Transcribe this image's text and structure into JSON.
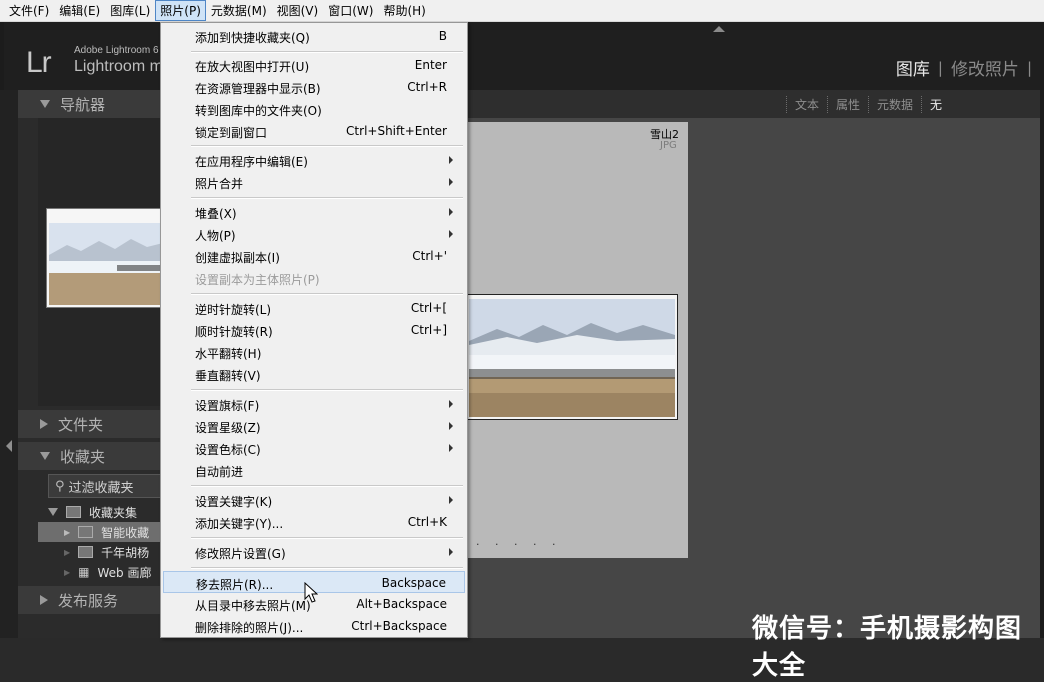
{
  "menubar": {
    "items": [
      {
        "label": "文件(F)"
      },
      {
        "label": "编辑(E)"
      },
      {
        "label": "图库(L)"
      },
      {
        "label": "照片(P)"
      },
      {
        "label": "元数据(M)"
      },
      {
        "label": "视图(V)"
      },
      {
        "label": "窗口(W)"
      },
      {
        "label": "帮助(H)"
      }
    ]
  },
  "identity": {
    "logo": "Lr",
    "brand_line1": "Adobe Lightroom 6",
    "brand_line2": "Lightroom m"
  },
  "modules": {
    "library": "图库",
    "develop": "修改照片"
  },
  "left_panel": {
    "navigator": "导航器",
    "folders": "文件夹",
    "collections": "收藏夹",
    "filter_placeholder": "过滤收藏夹",
    "collection_items": [
      {
        "label": "收藏夹集"
      },
      {
        "label": "智能收藏"
      },
      {
        "label": "千年胡杨"
      },
      {
        "label": "Web 画廊"
      }
    ],
    "publish": "发布服务"
  },
  "toolbar": {
    "items": [
      {
        "label": "文本"
      },
      {
        "label": "属性"
      },
      {
        "label": "元数据"
      },
      {
        "label": "无"
      }
    ]
  },
  "grid": {
    "cell_name": "雪山2",
    "cell_type": "JPG",
    "dots": "· · · · ·"
  },
  "watermark": "微信号：手机摄影构图大全",
  "photo_menu": {
    "items": [
      {
        "label": "添加到快捷收藏夹(Q)",
        "shortcut": "B"
      },
      {
        "label": "在放大视图中打开(U)",
        "shortcut": "Enter"
      },
      {
        "label": "在资源管理器中显示(B)",
        "shortcut": "Ctrl+R"
      },
      {
        "label": "转到图库中的文件夹(O)",
        "shortcut": ""
      },
      {
        "label": "锁定到副窗口",
        "shortcut": "Ctrl+Shift+Enter"
      },
      {
        "label": "在应用程序中编辑(E)",
        "shortcut": ""
      },
      {
        "label": "照片合并",
        "shortcut": ""
      },
      {
        "label": "堆叠(X)",
        "shortcut": ""
      },
      {
        "label": "人物(P)",
        "shortcut": ""
      },
      {
        "label": "创建虚拟副本(I)",
        "shortcut": "Ctrl+'"
      },
      {
        "label": "设置副本为主体照片(P)",
        "shortcut": ""
      },
      {
        "label": "逆时针旋转(L)",
        "shortcut": "Ctrl+["
      },
      {
        "label": "顺时针旋转(R)",
        "shortcut": "Ctrl+]"
      },
      {
        "label": "水平翻转(H)",
        "shortcut": ""
      },
      {
        "label": "垂直翻转(V)",
        "shortcut": ""
      },
      {
        "label": "设置旗标(F)",
        "shortcut": ""
      },
      {
        "label": "设置星级(Z)",
        "shortcut": ""
      },
      {
        "label": "设置色标(C)",
        "shortcut": ""
      },
      {
        "label": "自动前进",
        "shortcut": ""
      },
      {
        "label": "设置关键字(K)",
        "shortcut": ""
      },
      {
        "label": "添加关键字(Y)...",
        "shortcut": "Ctrl+K"
      },
      {
        "label": "修改照片设置(G)",
        "shortcut": ""
      },
      {
        "label": "移去照片(R)...",
        "shortcut": "Backspace"
      },
      {
        "label": "从目录中移去照片(M)",
        "shortcut": "Alt+Backspace"
      },
      {
        "label": "删除排除的照片(J)...",
        "shortcut": "Ctrl+Backspace"
      }
    ]
  }
}
